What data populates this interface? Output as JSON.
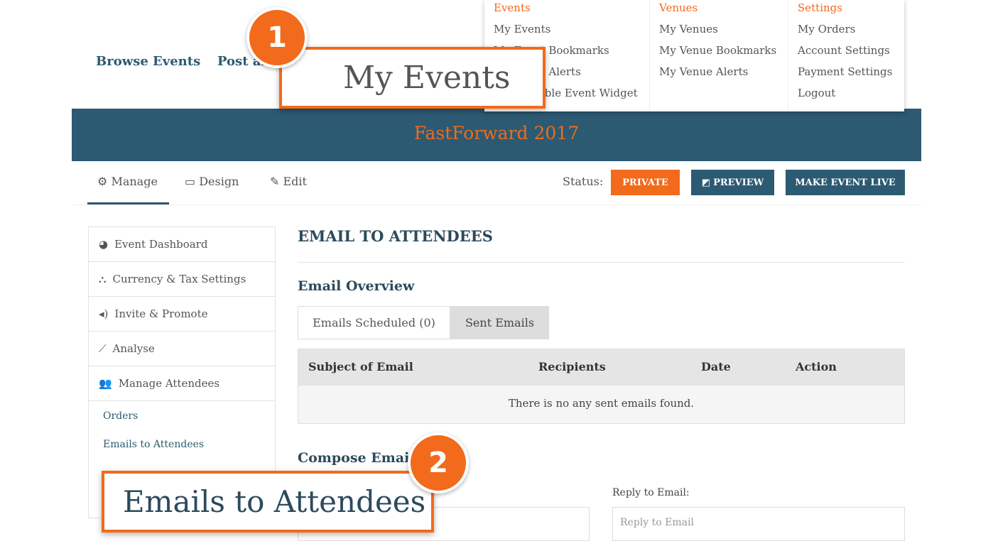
{
  "nav": {
    "browse": "Browse Events",
    "post": "Post an Event"
  },
  "dropdown": {
    "events": {
      "heading": "Events",
      "items": [
        "My Events",
        "My Event Bookmarks",
        "My Event Alerts",
        "Embeddable Event Widget"
      ]
    },
    "venues": {
      "heading": "Venues",
      "items": [
        "My Venues",
        "My Venue Bookmarks",
        "My Venue Alerts"
      ]
    },
    "settings": {
      "heading": "Settings",
      "items": [
        "My Orders",
        "Account Settings",
        "Payment Settings",
        "Logout"
      ]
    }
  },
  "banner": {
    "title": "FastForward 2017"
  },
  "tabs": {
    "manage": "Manage",
    "design": "Design",
    "edit": "Edit"
  },
  "status": {
    "label": "Status:",
    "value": "PRIVATE",
    "preview": "PREVIEW",
    "make_live": "MAKE EVENT LIVE"
  },
  "sidebar": {
    "items": [
      "Event Dashboard",
      "Currency & Tax Settings",
      "Invite & Promote",
      "Analyse",
      "Manage Attendees"
    ],
    "sub": [
      "Orders",
      "Emails to Attendees"
    ]
  },
  "main": {
    "title": "EMAIL TO ATTENDEES",
    "overview": "Email Overview",
    "tab_scheduled": "Emails Scheduled (0)",
    "tab_sent": "Sent Emails",
    "columns": [
      "Subject of Email",
      "Recipients",
      "Date",
      "Action"
    ],
    "empty": "There is no any sent emails found.",
    "compose": "Compose Email",
    "reply_label": "Reply to Email:",
    "reply_placeholder": "Reply to Email"
  },
  "callouts": [
    {
      "number": "1",
      "text": "My Events"
    },
    {
      "number": "2",
      "text": "Emails to Attendees"
    }
  ],
  "colors": {
    "brand": "#2c5a72",
    "accent": "#f26a1b"
  }
}
